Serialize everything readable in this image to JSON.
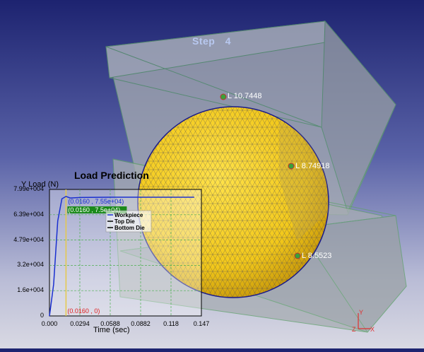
{
  "scene": {
    "step_label": "Step",
    "step_value": "4",
    "colors": {
      "sphere": "#f2c81a",
      "mesh": "#3a3a5a",
      "die": "#9aa2a8",
      "die_edge": "#5fa06a"
    },
    "markers": [
      {
        "label": "L 10.7448"
      },
      {
        "label": "L 8.74918"
      },
      {
        "label": "L 8.5523"
      }
    ]
  },
  "chart": {
    "title": "Load Prediction",
    "chart_data": {
      "type": "line",
      "xlabel": "Time (sec)",
      "ylabel": "Y Load (N)",
      "xlim": [
        0,
        0.147
      ],
      "ylim": [
        0,
        79900
      ],
      "x_ticks": [
        "0.000",
        "0.0294",
        "0.0588",
        "0.0882",
        "0.118",
        "0.147"
      ],
      "y_ticks": [
        "0",
        "1.6e+004",
        "3.2e+004",
        "4.79e+004",
        "6.39e+004",
        "7.99e+004"
      ],
      "series": [
        {
          "name": "Workpiece",
          "color": "#1a2fd0",
          "x": [
            0,
            0.004,
            0.008,
            0.012,
            0.016,
            0.02,
            0.03,
            0.06,
            0.09,
            0.12,
            0.14
          ],
          "y": [
            0,
            20000,
            60000,
            74000,
            75500,
            74500,
            74800,
            75000,
            75000,
            75000,
            75000
          ]
        },
        {
          "name": "Top Die",
          "color": "#000000",
          "x": [],
          "y": []
        },
        {
          "name": "Bottom Die",
          "color": "#000000",
          "x": [],
          "y": []
        }
      ],
      "annotations": [
        {
          "text": "(0.0160 , 7.55e+04)",
          "color": "#1a2fd0"
        },
        {
          "text": "(0.0160 , 7.5e+04)",
          "color": "#ffffff",
          "bg": "#1b8a1b"
        },
        {
          "text": "(0.0160 , 0)",
          "color": "#e02020"
        }
      ],
      "cursor_x": 0.016,
      "legend_placement": "top-right"
    }
  },
  "triad": {
    "y": "Y",
    "x": "X",
    "z": "Z"
  }
}
